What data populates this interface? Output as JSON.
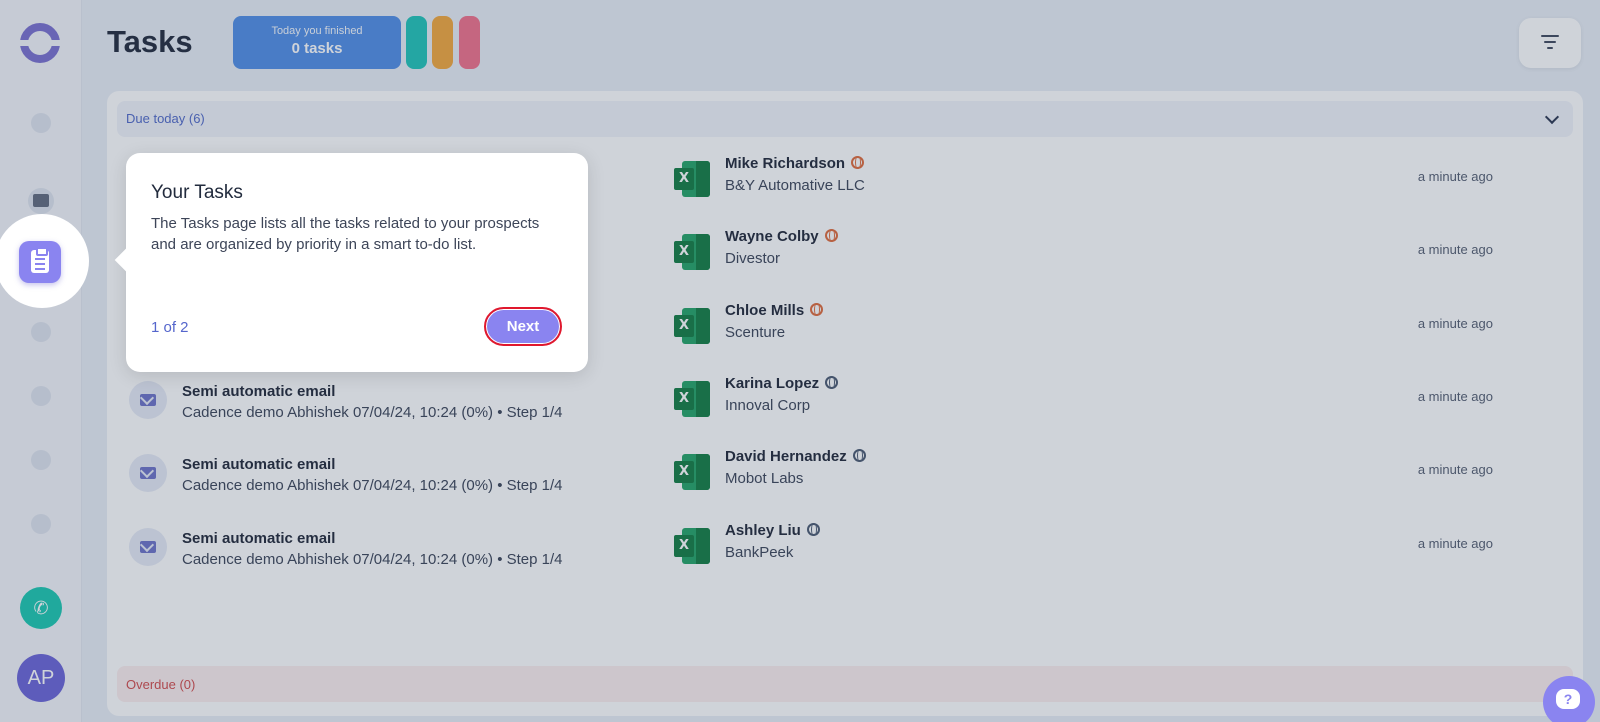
{
  "header": {
    "title": "Tasks",
    "finished_label": "Today you finished",
    "finished_count": "0 tasks"
  },
  "sidebar": {
    "avatar_initials": "AP"
  },
  "sections": {
    "due_today": "Due today (6)",
    "overdue": "Overdue (0)"
  },
  "rows": [
    {
      "task_title": "",
      "task_sub": "",
      "contact": "Mike Richardson",
      "company": "B&Y Automative LLC",
      "time": "a minute ago"
    },
    {
      "task_title": "",
      "task_sub": "",
      "contact": "Wayne Colby",
      "company": "Divestor",
      "time": "a minute ago"
    },
    {
      "task_title": "",
      "task_sub": "",
      "contact": "Chloe Mills",
      "company": "Scenture",
      "time": "a minute ago"
    },
    {
      "task_title": "Semi automatic email",
      "task_sub": "Cadence demo Abhishek 07/04/24, 10:24 (0%) • Step 1/4",
      "contact": "Karina Lopez",
      "company": "Innoval Corp",
      "time": "a minute ago"
    },
    {
      "task_title": "Semi automatic email",
      "task_sub": "Cadence demo Abhishek 07/04/24, 10:24 (0%) • Step 1/4",
      "contact": "David Hernandez",
      "company": "Mobot Labs",
      "time": "a minute ago"
    },
    {
      "task_title": "Semi automatic email",
      "task_sub": "Cadence demo Abhishek 07/04/24, 10:24 (0%) • Step 1/4",
      "contact": "Ashley Liu",
      "company": "BankPeek",
      "time": "a minute ago"
    }
  ],
  "tour": {
    "title": "Your Tasks",
    "body": "The Tasks page lists all the tasks related to your prospects and are organized by priority in a smart to-do list.",
    "step": "1 of 2",
    "next_label": "Next"
  },
  "colors": {
    "accent": "#8a84f0",
    "finished_bg": "#4f8de6",
    "teal": "#1fc4b8",
    "orange": "#f3a73b",
    "pink": "#f2708a",
    "overdue": "#d34a4a"
  },
  "icons": {
    "phone": "phone-icon",
    "help": "help-chat-icon",
    "filter": "filter-icon",
    "excel": "excel-icon",
    "email": "email-icon",
    "globe": "globe-icon"
  }
}
